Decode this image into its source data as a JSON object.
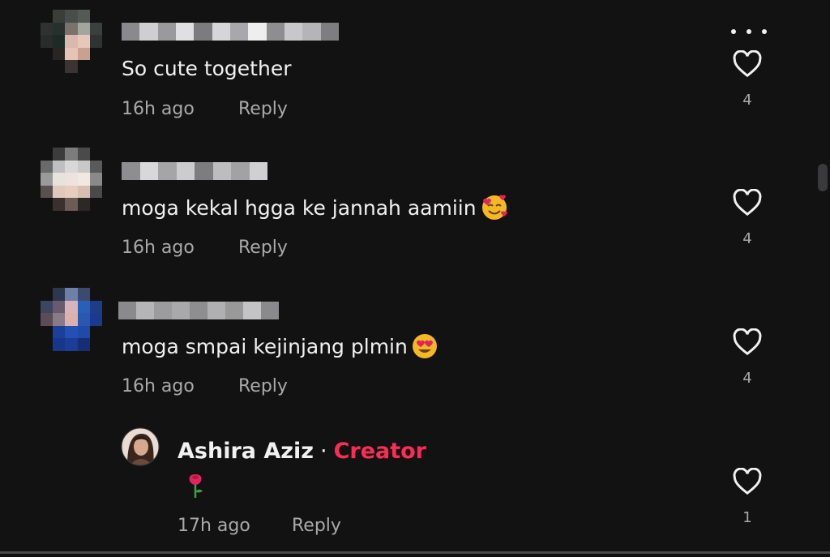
{
  "comments": [
    {
      "text": "So cute together",
      "time": "16h ago",
      "reply": "Reply",
      "likes": "4"
    },
    {
      "text": "moga kekal hgga ke jannah aamiin",
      "time": "16h ago",
      "reply": "Reply",
      "likes": "4",
      "emoji": "smiling-face-with-hearts"
    },
    {
      "text": "moga smpai kejinjang plmin",
      "time": "16h ago",
      "reply": "Reply",
      "likes": "4",
      "emoji": "heart-eyes"
    }
  ],
  "creator_reply": {
    "name": "Ashira Aziz",
    "separator": "·",
    "badge": "Creator",
    "emoji": "rose",
    "time": "17h ago",
    "reply": "Reply",
    "likes": "1"
  },
  "colors": {
    "background": "#121212",
    "text": "#f1f1f2",
    "muted": "#a9a9ab",
    "creator_badge": "#fe2c55"
  }
}
